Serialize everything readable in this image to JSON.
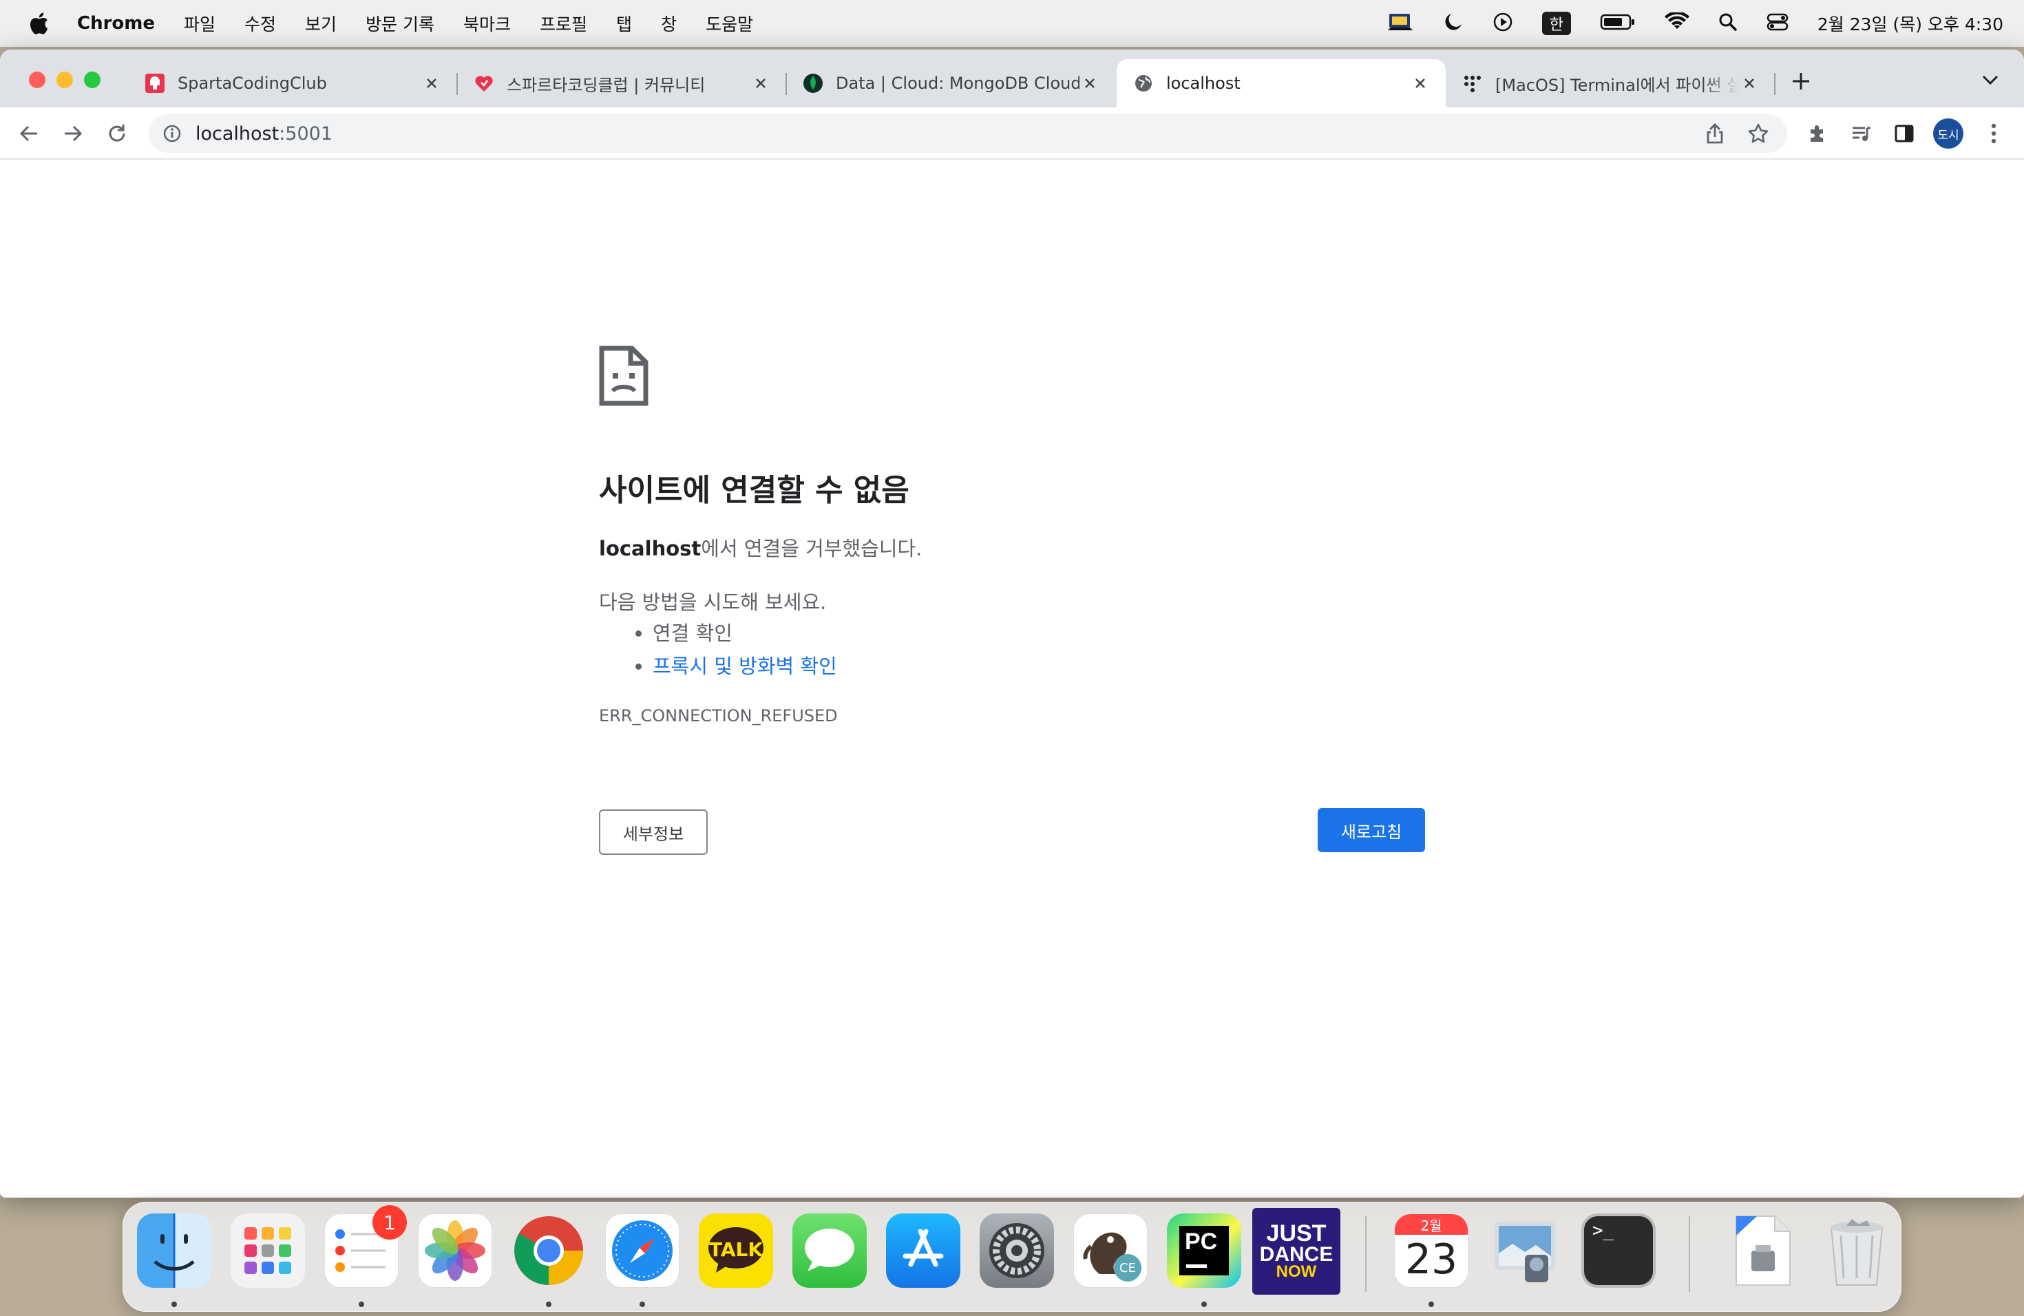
{
  "menubar": {
    "app_name": "Chrome",
    "items": [
      "파일",
      "수정",
      "보기",
      "방문 기록",
      "북마크",
      "프로필",
      "탭",
      "창",
      "도움말"
    ],
    "input_method": "한",
    "clock": "2월 23일 (목) 오후 4:30"
  },
  "tabs": [
    {
      "title": "SpartaCodingClub",
      "icon": "sparta-favicon"
    },
    {
      "title": "스파르타코딩클럽 | 커뮤니티",
      "icon": "heart-favicon"
    },
    {
      "title": "Data | Cloud: MongoDB Cloud",
      "icon": "mongodb-leaf-favicon"
    },
    {
      "title": "localhost",
      "icon": "globe-favicon",
      "active": true
    },
    {
      "title": "[MacOS] Terminal에서 파이썬 실행",
      "icon": "velog-dots-favicon"
    }
  ],
  "omnibox": {
    "host": "localhost",
    "port": ":5001"
  },
  "profile": {
    "initials": "도시"
  },
  "error": {
    "title": "사이트에 연결할 수 없음",
    "host": "localhost",
    "desc_suffix": "에서 연결을 거부했습니다.",
    "try_label": "다음 방법을 시도해 보세요.",
    "suggestion_1": "연결 확인",
    "suggestion_2": "프록시 및 방화벽 확인",
    "code": "ERR_CONNECTION_REFUSED",
    "details_label": "세부정보",
    "reload_label": "새로고침"
  },
  "dock": {
    "reminders_badge": "1",
    "kakaotalk_label": "TALK",
    "pycharm_label": "PC",
    "pycharm_ce_label": "CE",
    "justdance_line1": "JUST",
    "justdance_line2": "DANCE",
    "justdance_line3": "NOW",
    "calendar_month": "2월",
    "calendar_day": "23",
    "terminal_prompt": ">_"
  },
  "colors": {
    "accent": "#1a73e8",
    "tabstrip": "#dee1e6",
    "close_red": "#ff5f57",
    "minimize_yellow": "#febc2e",
    "zoom_green": "#28c840"
  }
}
